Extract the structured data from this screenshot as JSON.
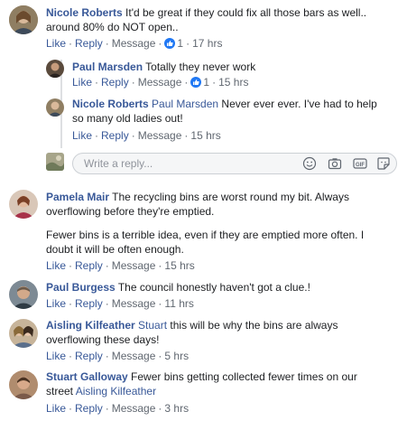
{
  "action_labels": {
    "like": "Like",
    "reply": "Reply",
    "message": "Message"
  },
  "comments": [
    {
      "author": "Nicole Roberts",
      "text": "It'd be great if they could fix all those bars as well.. around 80% do NOT open..",
      "like_count": "1",
      "time": "17 hrs",
      "replies": [
        {
          "author": "Paul Marsden",
          "text": "Totally they never work",
          "like_count": "1",
          "time": "15 hrs"
        },
        {
          "author": "Nicole Roberts",
          "tag": "Paul Marsden",
          "text": "Never ever ever. I've had to help so many old ladies out!",
          "time": "15 hrs"
        }
      ]
    },
    {
      "author": "Pamela Mair",
      "text": "The recycling bins are worst round my bit. Always overflowing before they're emptied.",
      "text2": "Fewer bins is a terrible idea, even if they are emptied more often. I doubt it will be often enough.",
      "time": "15 hrs"
    },
    {
      "author": "Paul Burgess",
      "text": "The council honestly haven't got a clue.!",
      "time": "11 hrs"
    },
    {
      "author": "Aisling Kilfeather",
      "tag": "Stuart",
      "text": "this will be why the bins are always overflowing these days!",
      "time": "5 hrs"
    },
    {
      "author": "Stuart Galloway",
      "text": "Fewer bins getting collected fewer times on our street",
      "tag_after": "Aisling Kilfeather",
      "time": "3 hrs"
    }
  ],
  "reply_box": {
    "placeholder": "Write a reply...",
    "value": ""
  },
  "icons": [
    "emoji-icon",
    "camera-icon",
    "gif-icon",
    "sticker-icon",
    "like-thumb-icon"
  ],
  "colors": {
    "link": "#385898",
    "meta": "#606770",
    "like_badge": "#2078f4",
    "input_bg": "#f5f6f7"
  }
}
